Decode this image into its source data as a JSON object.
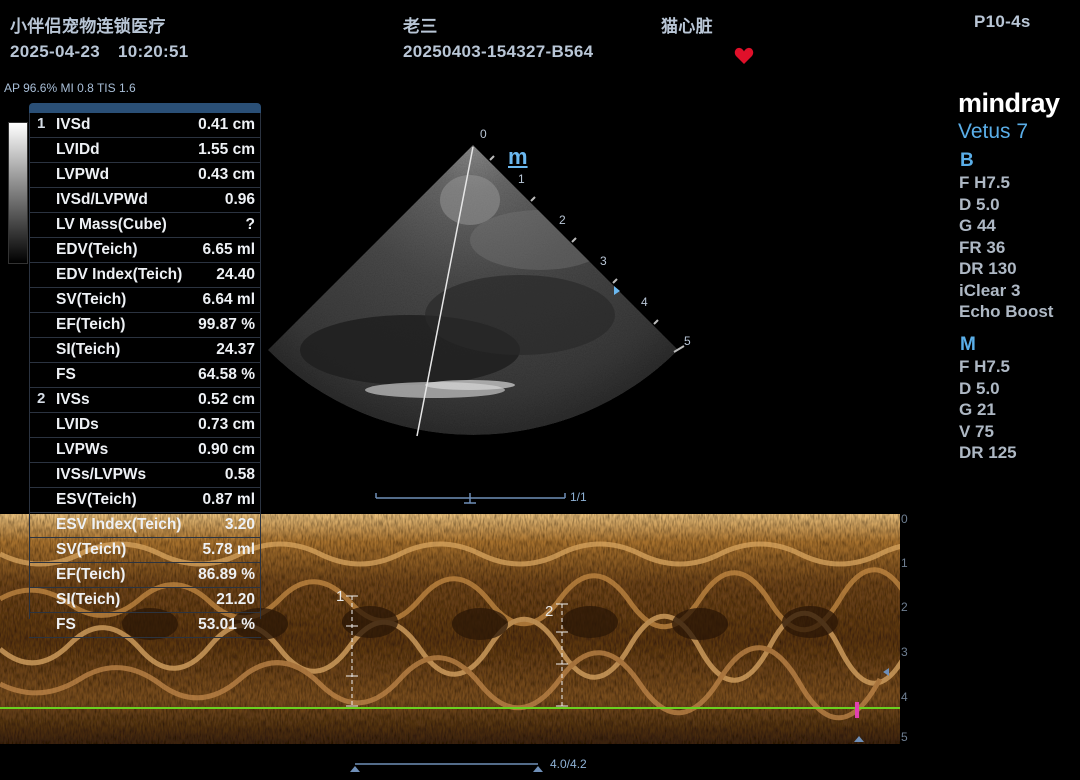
{
  "header": {
    "clinic": "小伴侣宠物连锁医疗",
    "date": "2025-04-23",
    "time": "10:20:51",
    "patient_name": "老三",
    "patient_id": "20250403-154327-B564",
    "exam": "猫心脏",
    "probe": "P10-4s",
    "acoustic": "AP 96.6%  MI 0.8 TIS 1.6"
  },
  "measurements": [
    {
      "group": "1",
      "label": "IVSd",
      "value": "0.41 cm"
    },
    {
      "group": "",
      "label": "LVIDd",
      "value": "1.55 cm"
    },
    {
      "group": "",
      "label": "LVPWd",
      "value": "0.43 cm"
    },
    {
      "group": "",
      "label": "IVSd/LVPWd",
      "value": "0.96"
    },
    {
      "group": "",
      "label": "LV Mass(Cube)",
      "value": "?"
    },
    {
      "group": "",
      "label": "EDV(Teich)",
      "value": "6.65 ml"
    },
    {
      "group": "",
      "label": "EDV Index(Teich)",
      "value": "24.40"
    },
    {
      "group": "",
      "label": "SV(Teich)",
      "value": "6.64 ml"
    },
    {
      "group": "",
      "label": "EF(Teich)",
      "value": "99.87 %"
    },
    {
      "group": "",
      "label": "SI(Teich)",
      "value": "24.37"
    },
    {
      "group": "",
      "label": "FS",
      "value": "64.58 %"
    },
    {
      "group": "2",
      "label": "IVSs",
      "value": "0.52 cm"
    },
    {
      "group": "",
      "label": "LVIDs",
      "value": "0.73 cm"
    },
    {
      "group": "",
      "label": "LVPWs",
      "value": "0.90 cm"
    },
    {
      "group": "",
      "label": "IVSs/LVPWs",
      "value": "0.58"
    },
    {
      "group": "",
      "label": "ESV(Teich)",
      "value": "0.87 ml"
    },
    {
      "group": "",
      "label": "ESV Index(Teich)",
      "value": "3.20"
    },
    {
      "group": "",
      "label": "SV(Teich)",
      "value": "5.78 ml"
    },
    {
      "group": "",
      "label": "EF(Teich)",
      "value": "86.89 %"
    },
    {
      "group": "",
      "label": "SI(Teich)",
      "value": "21.20"
    },
    {
      "group": "",
      "label": "FS",
      "value": "53.01 %"
    }
  ],
  "system": {
    "brand": "mindray",
    "model": "Vetus 7",
    "b_label": "B",
    "b_params": [
      "F H7.5",
      "D 5.0",
      "G 44",
      "FR 36",
      "DR 130",
      "iClear 3",
      "Echo Boost"
    ],
    "m_label": "M",
    "m_params": [
      "F H7.5",
      "D 5.0",
      "G 21",
      "V 75",
      "DR 125"
    ]
  },
  "image": {
    "m_marker": "m",
    "sector_depths": [
      "0",
      "1",
      "2",
      "3",
      "4",
      "5"
    ],
    "frame": "1/1",
    "mmode_depths": [
      "0",
      "1",
      "2",
      "3",
      "4",
      "5"
    ],
    "caliper_1": "1",
    "caliper_2": "2",
    "time_scale": "4.0/4.2"
  },
  "colors": {
    "accent": "#5aaee8",
    "header_text": "#b9c6d6",
    "table_header": "#2a4f76",
    "heart": "#e0102a",
    "ecg_line": "#6bd020"
  }
}
